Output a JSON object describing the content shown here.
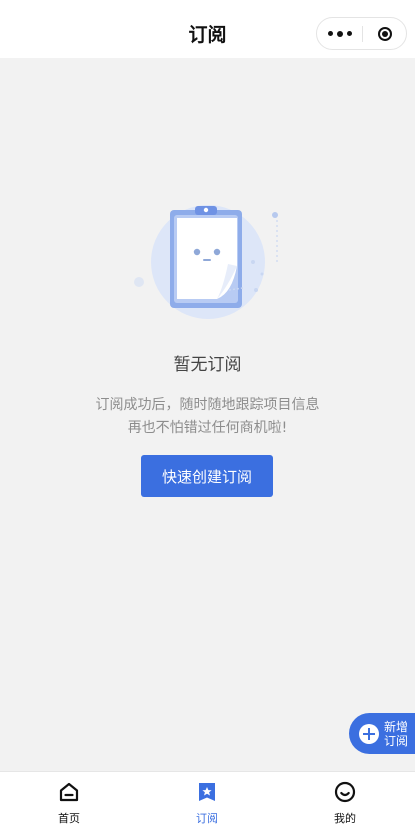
{
  "header": {
    "title": "订阅",
    "more_icon": "more-dots-icon",
    "close_icon": "target-circle-icon"
  },
  "empty_state": {
    "illustration": "clipboard-face-illustration",
    "title": "暂无订阅",
    "desc_line1": "订阅成功后，随时随地跟踪项目信息",
    "desc_line2": "再也不怕错过任何商机啦!",
    "action_label": "快速创建订阅"
  },
  "fab": {
    "icon": "plus-circle-icon",
    "label": "新增订阅"
  },
  "tabbar": {
    "tabs": [
      {
        "label": "首页",
        "icon": "home-icon",
        "active": false
      },
      {
        "label": "订阅",
        "icon": "bookmark-star-icon",
        "active": true
      },
      {
        "label": "我的",
        "icon": "smile-face-icon",
        "active": false
      }
    ]
  },
  "colors": {
    "accent": "#3b6fe0",
    "background": "#f2f2f2",
    "text_muted": "#8d8d8d"
  }
}
